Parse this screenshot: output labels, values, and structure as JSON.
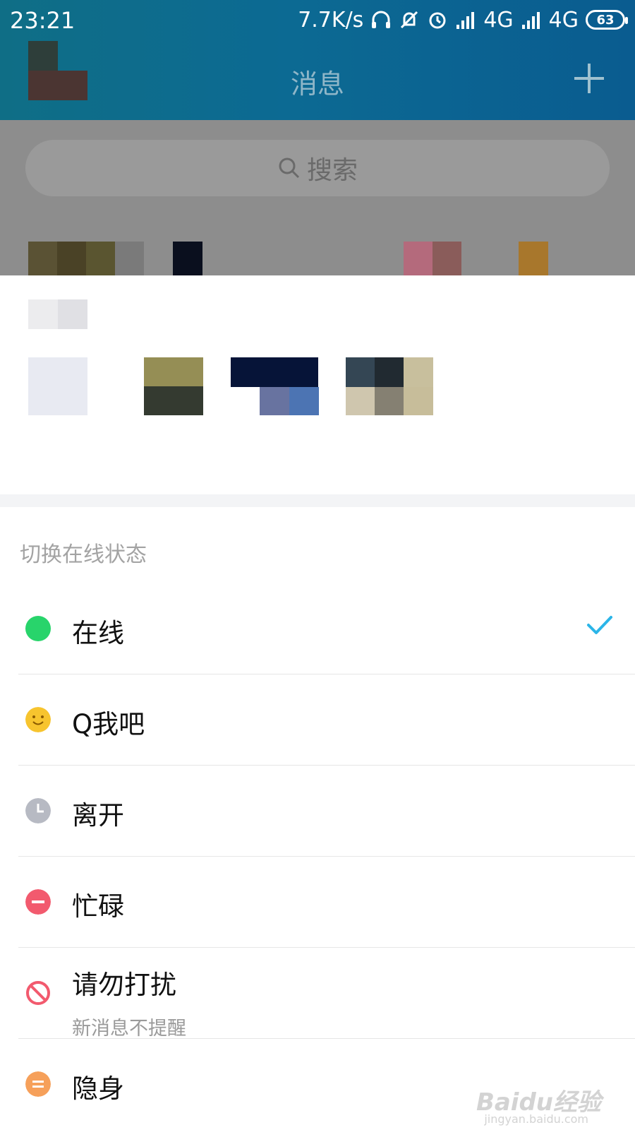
{
  "status_bar": {
    "time": "23:21",
    "network_speed": "7.7K/s",
    "signal_1": "4G",
    "signal_2": "4G",
    "battery": "63"
  },
  "header": {
    "title": "消息"
  },
  "search": {
    "placeholder": "搜索"
  },
  "status_menu": {
    "title": "切换在线状态",
    "items": [
      {
        "label": "在线",
        "icon": "online-dot-icon",
        "color": "#28d46b",
        "selected": true
      },
      {
        "label": "Q我吧",
        "icon": "smiley-icon",
        "color": "#f7c42e",
        "selected": false
      },
      {
        "label": "离开",
        "icon": "clock-icon",
        "color": "#b7bac3",
        "selected": false
      },
      {
        "label": "忙碌",
        "icon": "minus-circle-icon",
        "color": "#f25a6e",
        "selected": false
      },
      {
        "label": "请勿打扰",
        "sublabel": "新消息不提醒",
        "icon": "no-disturb-icon",
        "color": "#f25a6e",
        "selected": false
      },
      {
        "label": "隐身",
        "icon": "invisible-icon",
        "color": "#f6a05a",
        "selected": false
      }
    ]
  },
  "colors": {
    "accent_check": "#2bb5e8",
    "header_start": "#0f6e86",
    "header_end": "#0a5c90"
  },
  "watermark": {
    "text": "Baidu经验",
    "url": "jingyan.baidu.com"
  }
}
